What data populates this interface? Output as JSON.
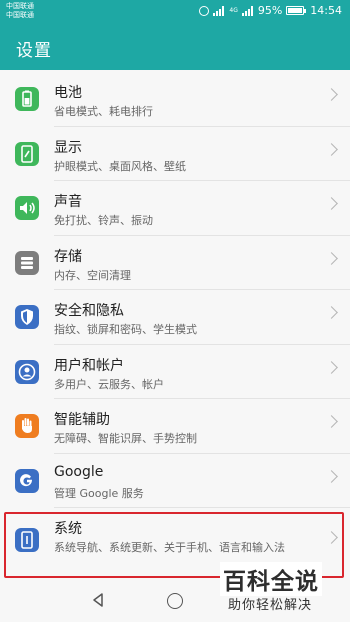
{
  "status": {
    "carrier1": "中国联通",
    "carrier2": "中国联通",
    "net": "4G",
    "battery": "95%",
    "battery_level": 0.95,
    "time": "14:54"
  },
  "appbar": {
    "title": "设置"
  },
  "items": [
    {
      "title": "电池",
      "sub": "省电模式、耗电排行",
      "icon": "battery-icon",
      "color": "#3fb75b"
    },
    {
      "title": "显示",
      "sub": "护眼模式、桌面风格、壁纸",
      "icon": "display-icon",
      "color": "#3fb75b"
    },
    {
      "title": "声音",
      "sub": "免打扰、铃声、振动",
      "icon": "sound-icon",
      "color": "#3fb75b"
    },
    {
      "title": "存储",
      "sub": "内存、空间清理",
      "icon": "storage-icon",
      "color": "#7d7d7d"
    },
    {
      "title": "安全和隐私",
      "sub": "指纹、锁屏和密码、学生模式",
      "icon": "shield-icon",
      "color": "#3b6fc4"
    },
    {
      "title": "用户和帐户",
      "sub": "多用户、云服务、帐户",
      "icon": "user-icon",
      "color": "#3b6fc4"
    },
    {
      "title": "智能辅助",
      "sub": "无障碍、智能识屏、手势控制",
      "icon": "hand-icon",
      "color": "#ef7d20"
    },
    {
      "title": "Google",
      "sub": "管理 Google 服务",
      "icon": "google-icon",
      "color": "#3b6fc4"
    },
    {
      "title": "系统",
      "sub": "系统导航、系统更新、关于手机、语言和输入法",
      "icon": "system-icon",
      "color": "#3b6fc4"
    }
  ],
  "watermark": {
    "big": "百科全说",
    "small": "助你轻松解决"
  }
}
